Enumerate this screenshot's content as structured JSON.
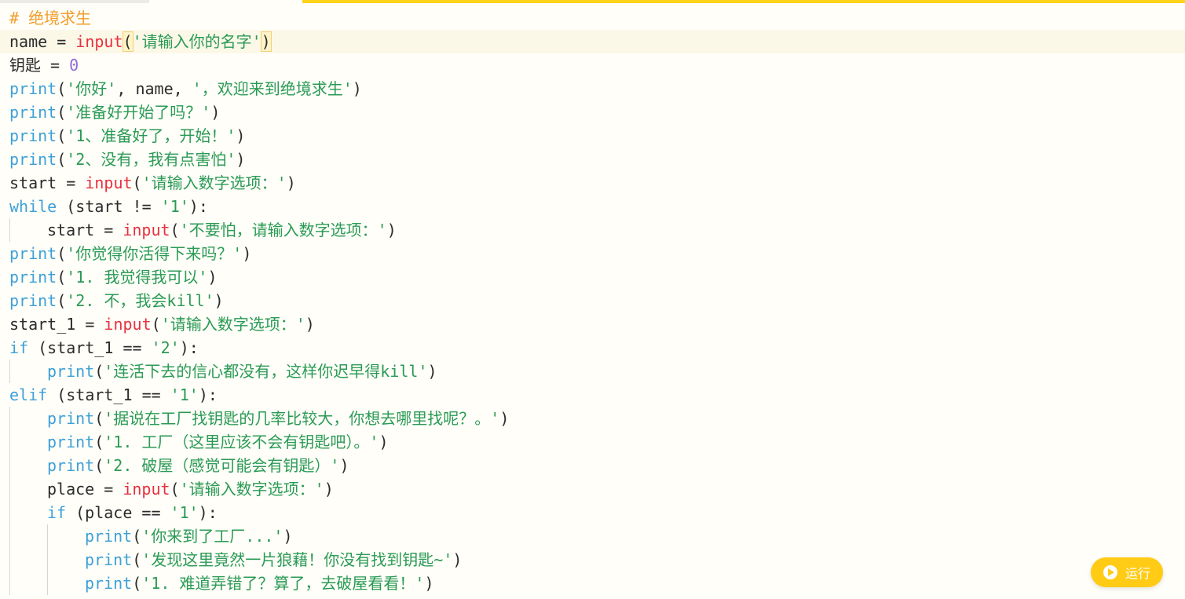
{
  "editor": {
    "language": "python",
    "colors": {
      "comment": "#f29d2b",
      "keyword": "#3da0d8",
      "function": "#e8303f",
      "string": "#2a9a55",
      "number": "#8f6ad8",
      "accent": "#ffd31a"
    },
    "active_line": 2,
    "lines": [
      {
        "indent": 0,
        "tokens": [
          {
            "t": "comment",
            "v": "# 绝境求生"
          }
        ]
      },
      {
        "indent": 0,
        "tokens": [
          {
            "t": "text",
            "v": "name = "
          },
          {
            "t": "func",
            "v": "input"
          },
          {
            "t": "paren",
            "v": "("
          },
          {
            "t": "str",
            "v": "'请输入你的名字'"
          },
          {
            "t": "paren",
            "v": ")"
          }
        ]
      },
      {
        "indent": 0,
        "tokens": [
          {
            "t": "text",
            "v": "钥匙 = "
          },
          {
            "t": "num",
            "v": "0"
          }
        ]
      },
      {
        "indent": 0,
        "tokens": [
          {
            "t": "builtin",
            "v": "print"
          },
          {
            "t": "text",
            "v": "("
          },
          {
            "t": "str",
            "v": "'你好'"
          },
          {
            "t": "text",
            "v": ", name, "
          },
          {
            "t": "str",
            "v": "'，欢迎来到绝境求生'"
          },
          {
            "t": "text",
            "v": ")"
          }
        ]
      },
      {
        "indent": 0,
        "tokens": [
          {
            "t": "builtin",
            "v": "print"
          },
          {
            "t": "text",
            "v": "("
          },
          {
            "t": "str",
            "v": "'准备好开始了吗？'"
          },
          {
            "t": "text",
            "v": ")"
          }
        ]
      },
      {
        "indent": 0,
        "tokens": [
          {
            "t": "builtin",
            "v": "print"
          },
          {
            "t": "text",
            "v": "("
          },
          {
            "t": "str",
            "v": "'1、准备好了，开始！'"
          },
          {
            "t": "text",
            "v": ")"
          }
        ]
      },
      {
        "indent": 0,
        "tokens": [
          {
            "t": "builtin",
            "v": "print"
          },
          {
            "t": "text",
            "v": "("
          },
          {
            "t": "str",
            "v": "'2、没有，我有点害怕'"
          },
          {
            "t": "text",
            "v": ")"
          }
        ]
      },
      {
        "indent": 0,
        "tokens": [
          {
            "t": "text",
            "v": "start = "
          },
          {
            "t": "func",
            "v": "input"
          },
          {
            "t": "text",
            "v": "("
          },
          {
            "t": "str",
            "v": "'请输入数字选项：'"
          },
          {
            "t": "text",
            "v": ")"
          }
        ]
      },
      {
        "indent": 0,
        "tokens": [
          {
            "t": "kw",
            "v": "while"
          },
          {
            "t": "text",
            "v": " (start != "
          },
          {
            "t": "str",
            "v": "'1'"
          },
          {
            "t": "text",
            "v": "):"
          }
        ]
      },
      {
        "indent": 1,
        "tokens": [
          {
            "t": "text",
            "v": "start = "
          },
          {
            "t": "func",
            "v": "input"
          },
          {
            "t": "text",
            "v": "("
          },
          {
            "t": "str",
            "v": "'不要怕，请输入数字选项：'"
          },
          {
            "t": "text",
            "v": ")"
          }
        ]
      },
      {
        "indent": 0,
        "tokens": [
          {
            "t": "builtin",
            "v": "print"
          },
          {
            "t": "text",
            "v": "("
          },
          {
            "t": "str",
            "v": "'你觉得你活得下来吗？'"
          },
          {
            "t": "text",
            "v": ")"
          }
        ]
      },
      {
        "indent": 0,
        "tokens": [
          {
            "t": "builtin",
            "v": "print"
          },
          {
            "t": "text",
            "v": "("
          },
          {
            "t": "str",
            "v": "'1. 我觉得我可以'"
          },
          {
            "t": "text",
            "v": ")"
          }
        ]
      },
      {
        "indent": 0,
        "tokens": [
          {
            "t": "builtin",
            "v": "print"
          },
          {
            "t": "text",
            "v": "("
          },
          {
            "t": "str",
            "v": "'2. 不，我会kill'"
          },
          {
            "t": "text",
            "v": ")"
          }
        ]
      },
      {
        "indent": 0,
        "tokens": [
          {
            "t": "text",
            "v": "start_1 = "
          },
          {
            "t": "func",
            "v": "input"
          },
          {
            "t": "text",
            "v": "("
          },
          {
            "t": "str",
            "v": "'请输入数字选项：'"
          },
          {
            "t": "text",
            "v": ")"
          }
        ]
      },
      {
        "indent": 0,
        "tokens": [
          {
            "t": "kw",
            "v": "if"
          },
          {
            "t": "text",
            "v": " (start_1 == "
          },
          {
            "t": "str",
            "v": "'2'"
          },
          {
            "t": "text",
            "v": "):"
          }
        ]
      },
      {
        "indent": 1,
        "tokens": [
          {
            "t": "builtin",
            "v": "print"
          },
          {
            "t": "text",
            "v": "("
          },
          {
            "t": "str",
            "v": "'连活下去的信心都没有，这样你迟早得kill'"
          },
          {
            "t": "text",
            "v": ")"
          }
        ]
      },
      {
        "indent": 0,
        "tokens": [
          {
            "t": "kw",
            "v": "elif"
          },
          {
            "t": "text",
            "v": " (start_1 == "
          },
          {
            "t": "str",
            "v": "'1'"
          },
          {
            "t": "text",
            "v": "):"
          }
        ]
      },
      {
        "indent": 1,
        "tokens": [
          {
            "t": "builtin",
            "v": "print"
          },
          {
            "t": "text",
            "v": "("
          },
          {
            "t": "str",
            "v": "'据说在工厂找钥匙的几率比较大，你想去哪里找呢？。'"
          },
          {
            "t": "text",
            "v": ")"
          }
        ]
      },
      {
        "indent": 1,
        "tokens": [
          {
            "t": "builtin",
            "v": "print"
          },
          {
            "t": "text",
            "v": "("
          },
          {
            "t": "str",
            "v": "'1. 工厂（这里应该不会有钥匙吧）。'"
          },
          {
            "t": "text",
            "v": ")"
          }
        ]
      },
      {
        "indent": 1,
        "tokens": [
          {
            "t": "builtin",
            "v": "print"
          },
          {
            "t": "text",
            "v": "("
          },
          {
            "t": "str",
            "v": "'2. 破屋（感觉可能会有钥匙）'"
          },
          {
            "t": "text",
            "v": ")"
          }
        ]
      },
      {
        "indent": 1,
        "tokens": [
          {
            "t": "text",
            "v": "place = "
          },
          {
            "t": "func",
            "v": "input"
          },
          {
            "t": "text",
            "v": "("
          },
          {
            "t": "str",
            "v": "'请输入数字选项：'"
          },
          {
            "t": "text",
            "v": ")"
          }
        ]
      },
      {
        "indent": 1,
        "tokens": [
          {
            "t": "kw",
            "v": "if"
          },
          {
            "t": "text",
            "v": " (place == "
          },
          {
            "t": "str",
            "v": "'1'"
          },
          {
            "t": "text",
            "v": "):"
          }
        ]
      },
      {
        "indent": 2,
        "tokens": [
          {
            "t": "builtin",
            "v": "print"
          },
          {
            "t": "text",
            "v": "("
          },
          {
            "t": "str",
            "v": "'你来到了工厂...'"
          },
          {
            "t": "text",
            "v": ")"
          }
        ]
      },
      {
        "indent": 2,
        "tokens": [
          {
            "t": "builtin",
            "v": "print"
          },
          {
            "t": "text",
            "v": "("
          },
          {
            "t": "str",
            "v": "'发现这里竟然一片狼藉！你没有找到钥匙~'"
          },
          {
            "t": "text",
            "v": ")"
          }
        ]
      },
      {
        "indent": 2,
        "tokens": [
          {
            "t": "builtin",
            "v": "print"
          },
          {
            "t": "text",
            "v": "("
          },
          {
            "t": "str",
            "v": "'1. 难道弄错了？算了，去破屋看看！'"
          },
          {
            "t": "text",
            "v": ")"
          }
        ]
      }
    ]
  },
  "run_button": {
    "label": "运行",
    "icon": "play-icon"
  }
}
